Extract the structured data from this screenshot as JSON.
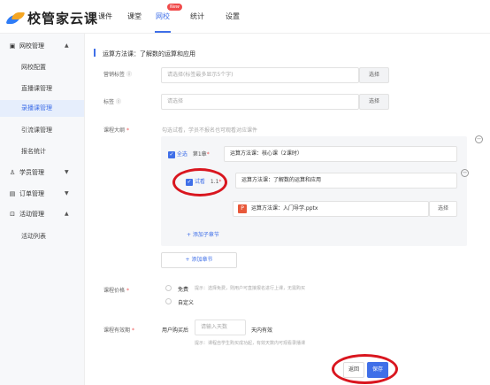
{
  "app": {
    "name": "校管家云课"
  },
  "nav": {
    "items": [
      "课件",
      "课堂",
      "网校",
      "统计",
      "设置"
    ],
    "new_badge": "New"
  },
  "sidebar": {
    "group1": "网校管理",
    "items": [
      "网校配置",
      "直播课管理",
      "录播课管理",
      "引流课管理",
      "报名统计"
    ],
    "group2": "学员管理",
    "group3": "订单管理",
    "group4": "活动管理",
    "group4_items": [
      "活动列表"
    ]
  },
  "form": {
    "section_title": "运算方法课：了解数的运算和应用",
    "marketing_label": "营销标签",
    "marketing_placeholder": "请选择(标签最多显示5个字)",
    "tags_label": "标签",
    "tags_placeholder": "请选择",
    "select_btn": "选择",
    "outline_label": "课程大纲",
    "outline_hint": "勾选试看，学员不报名也可观看对应课件",
    "select_all": "全选",
    "chapter_no": "第1章",
    "chapter_title": "运算方法课：核心课（2课时）",
    "trial": "试看",
    "section_no": "1.1",
    "file_name": "运算方法课：入门导学.pptx",
    "add_sub_section": "+ 添加子章节",
    "add_chapter": "+ 添加章节",
    "price_label": "课程价格",
    "price_free": "免费",
    "price_free_hint": "提示：选择免费，则用户可直接报名进行上课，无需购买",
    "price_custom": "自定义",
    "validity_label": "课程有效期",
    "validity_prefix": "用户购买后",
    "validity_placeholder": "请输入天数",
    "validity_suffix": "天内有效",
    "validity_hint": "提示：课程自学生购买成功起，有效天数内可观看录播课",
    "btn_back": "返回",
    "btn_save": "保存"
  },
  "colors": {
    "primary": "#3f6fe8",
    "annotation": "#d9161f",
    "badge": "#f04b4b"
  }
}
